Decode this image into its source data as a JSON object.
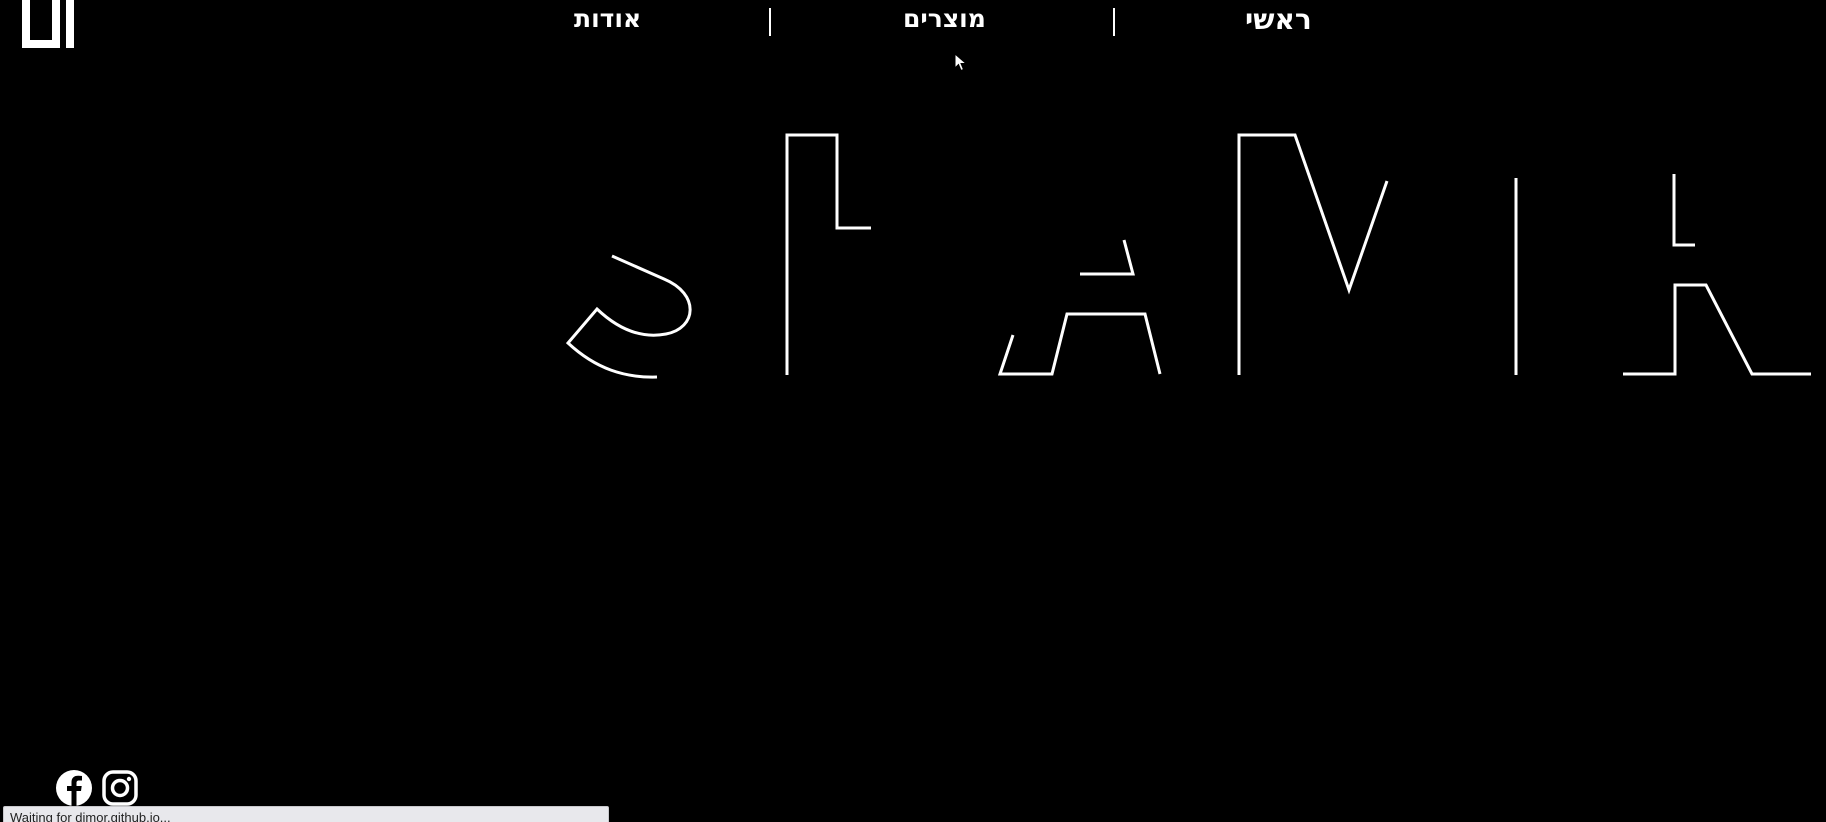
{
  "nav": {
    "home_label": "ראשי",
    "products_label": "מוצרים",
    "about_label": "אודות"
  },
  "social": {
    "facebook_icon": "facebook-icon",
    "instagram_icon": "instagram-icon"
  },
  "status_bar": {
    "text": "Waiting for dimor.github.io..."
  },
  "colors": {
    "background": "#000000",
    "foreground": "#ffffff",
    "status_bg": "#e8e8ec"
  }
}
